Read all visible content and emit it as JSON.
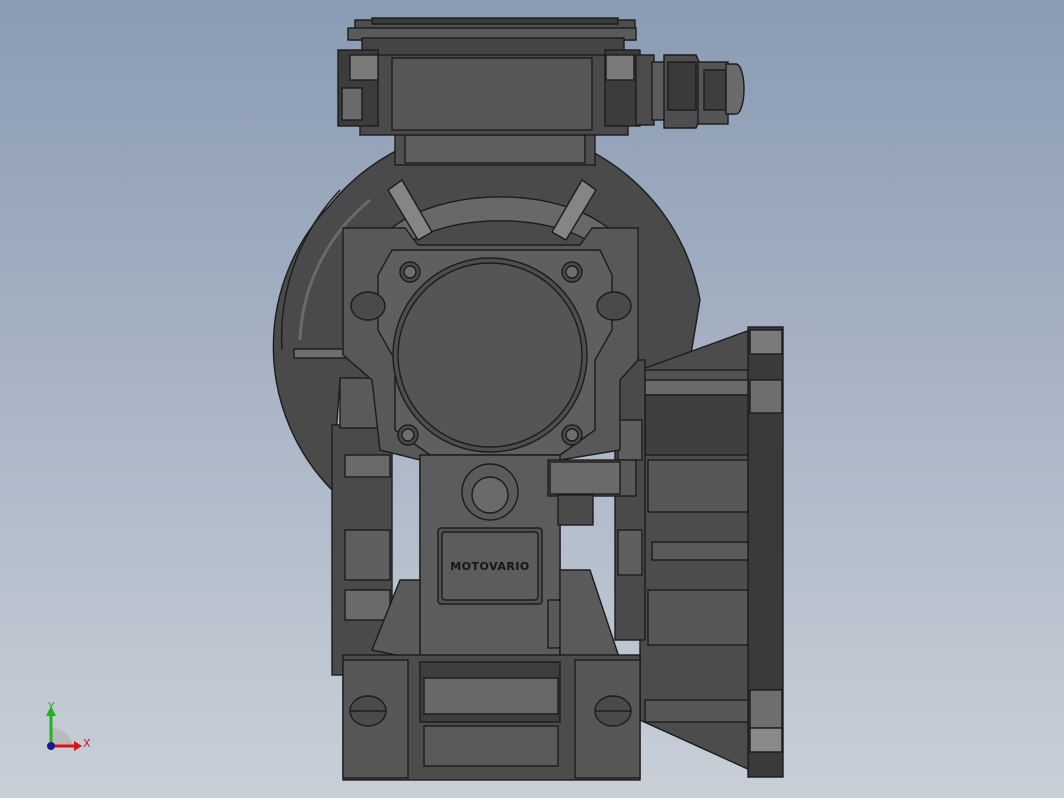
{
  "viewport": {
    "background_top": "#8a9bb3",
    "background_bottom": "#c9cfd8"
  },
  "model": {
    "nameplate_text": "MOTOVARIO",
    "body_color": "#5a5a5a",
    "dark_color": "#3e3e3e",
    "light_color": "#7a7a7a",
    "edge_color": "#1c1c1c"
  },
  "triad": {
    "y_label": "Y",
    "x_label": "X",
    "y_color": "#1fb31f",
    "x_color": "#d01818",
    "origin_color": "#1a1a8a"
  }
}
